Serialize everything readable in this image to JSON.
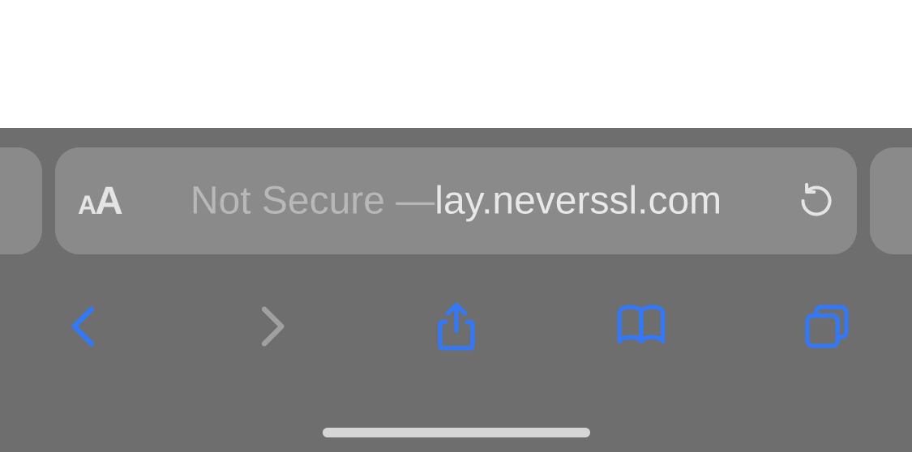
{
  "addressBar": {
    "securityStatus": "Not Secure — ",
    "urlVisible": "lay.neverssl.com",
    "textSizeSmall": "A",
    "textSizeLarge": "A"
  },
  "toolbar": {
    "backEnabled": true,
    "forwardEnabled": false
  },
  "colors": {
    "accent": "#3478f6",
    "chromeBg": "#6e6e6e",
    "pillBg": "#8a8a8a"
  }
}
